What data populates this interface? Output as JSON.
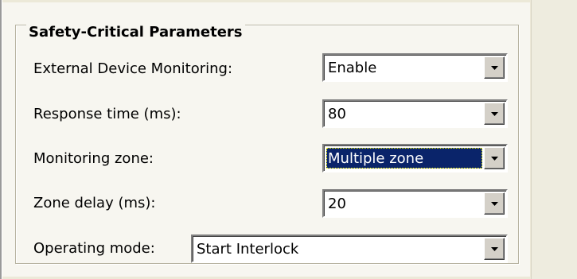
{
  "group": {
    "title": "Safety-Critical Parameters"
  },
  "fields": [
    {
      "label": "External Device Monitoring:",
      "value": "Enable"
    },
    {
      "label": "Response time (ms):",
      "value": "80"
    },
    {
      "label": "Monitoring zone:",
      "value": "Multiple zone",
      "focused": true
    },
    {
      "label": "Zone delay (ms):",
      "value": "20"
    },
    {
      "label": "Operating mode:",
      "value": "Start Interlock"
    }
  ],
  "icons": {
    "dropdown": "chevron-down-icon"
  }
}
